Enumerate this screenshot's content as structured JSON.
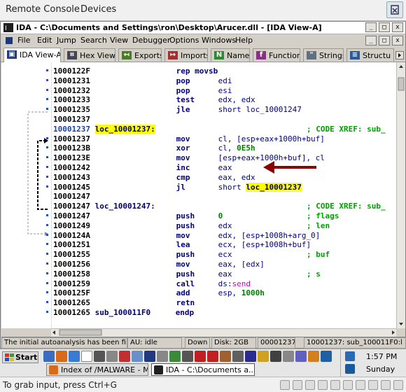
{
  "console": {
    "menu": [
      "Remote Console",
      "Devices"
    ]
  },
  "window": {
    "title": "IDA - C:\\Documents and Settings\\ron\\Desktop\\Arucer.dll - [IDA View-A]",
    "controls": [
      "_",
      "□",
      "x"
    ],
    "menu": [
      "File",
      "Edit",
      "Jump",
      "Search",
      "View",
      "Debugger",
      "Options",
      "Windows",
      "Help"
    ],
    "tabs": [
      "IDA View-A",
      "Hex View-A",
      "Exports",
      "Imports",
      "Names",
      "Functions",
      "Strings",
      "Structu"
    ],
    "tab_icons": [
      "▣",
      "⌗",
      "↤",
      "↦",
      "N",
      "f",
      "\"",
      "≡"
    ]
  },
  "disasm": [
    {
      "addr": "1000122F",
      "label": "",
      "mn": "rep movsb",
      "ops": "",
      "comment": ""
    },
    {
      "addr": "10001231",
      "label": "",
      "mn": "pop",
      "ops": "edi",
      "comment": ""
    },
    {
      "addr": "10001232",
      "label": "",
      "mn": "pop",
      "ops": "esi",
      "comment": ""
    },
    {
      "addr": "10001233",
      "label": "",
      "mn": "test",
      "ops": "edx, edx",
      "comment": ""
    },
    {
      "addr": "10001235",
      "label": "",
      "mn": "jle",
      "ops": "short loc_10001247",
      "comment": ""
    },
    {
      "addr": "10001237",
      "label": "",
      "mn": "",
      "ops": "",
      "comment": ""
    },
    {
      "addr": "10001237",
      "label": "loc_10001237:",
      "mn": "",
      "ops": "",
      "comment": "; CODE XREF: sub_"
    },
    {
      "addr": "10001237",
      "label": "",
      "mn": "mov",
      "ops": "cl, [esp+eax+1000h+buf]",
      "comment": ""
    },
    {
      "addr": "1000123B",
      "label": "",
      "mn": "xor",
      "ops": "cl, 0E5h",
      "comment": ""
    },
    {
      "addr": "1000123E",
      "label": "",
      "mn": "mov",
      "ops": "[esp+eax+1000h+buf], cl",
      "comment": ""
    },
    {
      "addr": "10001242",
      "label": "",
      "mn": "inc",
      "ops": "eax",
      "comment": ""
    },
    {
      "addr": "10001243",
      "label": "",
      "mn": "cmp",
      "ops": "eax, edx",
      "comment": ""
    },
    {
      "addr": "10001245",
      "label": "",
      "mn": "jl",
      "ops": "short loc_10001237",
      "comment": ""
    },
    {
      "addr": "10001247",
      "label": "",
      "mn": "",
      "ops": "",
      "comment": ""
    },
    {
      "addr": "10001247",
      "label": "loc_10001247:",
      "mn": "",
      "ops": "",
      "comment": "; CODE XREF: sub_"
    },
    {
      "addr": "10001247",
      "label": "",
      "mn": "push",
      "ops": "0",
      "comment": "; flags"
    },
    {
      "addr": "10001249",
      "label": "",
      "mn": "push",
      "ops": "edx",
      "comment": "; len"
    },
    {
      "addr": "1000124A",
      "label": "",
      "mn": "mov",
      "ops": "edx, [esp+1008h+arg_0]",
      "comment": ""
    },
    {
      "addr": "10001251",
      "label": "",
      "mn": "lea",
      "ops": "ecx, [esp+1008h+buf]",
      "comment": ""
    },
    {
      "addr": "10001255",
      "label": "",
      "mn": "push",
      "ops": "ecx",
      "comment": "; buf"
    },
    {
      "addr": "10001256",
      "label": "",
      "mn": "mov",
      "ops": "eax, [edx]",
      "comment": ""
    },
    {
      "addr": "10001258",
      "label": "",
      "mn": "push",
      "ops": "eax",
      "comment": "; s"
    },
    {
      "addr": "10001259",
      "label": "",
      "mn": "call",
      "ops": "ds:send",
      "comment": ""
    },
    {
      "addr": "1000125F",
      "label": "",
      "mn": "add",
      "ops": "esp, 1000h",
      "comment": ""
    },
    {
      "addr": "10001265",
      "label": "",
      "mn": "retn",
      "ops": "",
      "comment": ""
    },
    {
      "addr": "10001265",
      "label": "sub_100011F0",
      "mn": "endp",
      "ops": "",
      "comment": ""
    }
  ],
  "status": {
    "message": "The initial autoanalysis has been finished.",
    "au": "AU:",
    "au_state": "idle",
    "scroll": "Down",
    "disk": "Disk: 2GB",
    "offset": "00001237",
    "location": "10001237: sub_100011F0:l"
  },
  "taskbar": {
    "start": "Start",
    "tasks": [
      "Index of /MALWARE - M...",
      "IDA - C:\\Documents a..."
    ],
    "time": "1:57 PM",
    "day": "Sunday"
  },
  "bottom": {
    "hint": "To grab input, press Ctrl+G"
  },
  "colors": {
    "highlight": "#ffff00",
    "arrow": "#8b0000",
    "comment": "#00a000"
  }
}
